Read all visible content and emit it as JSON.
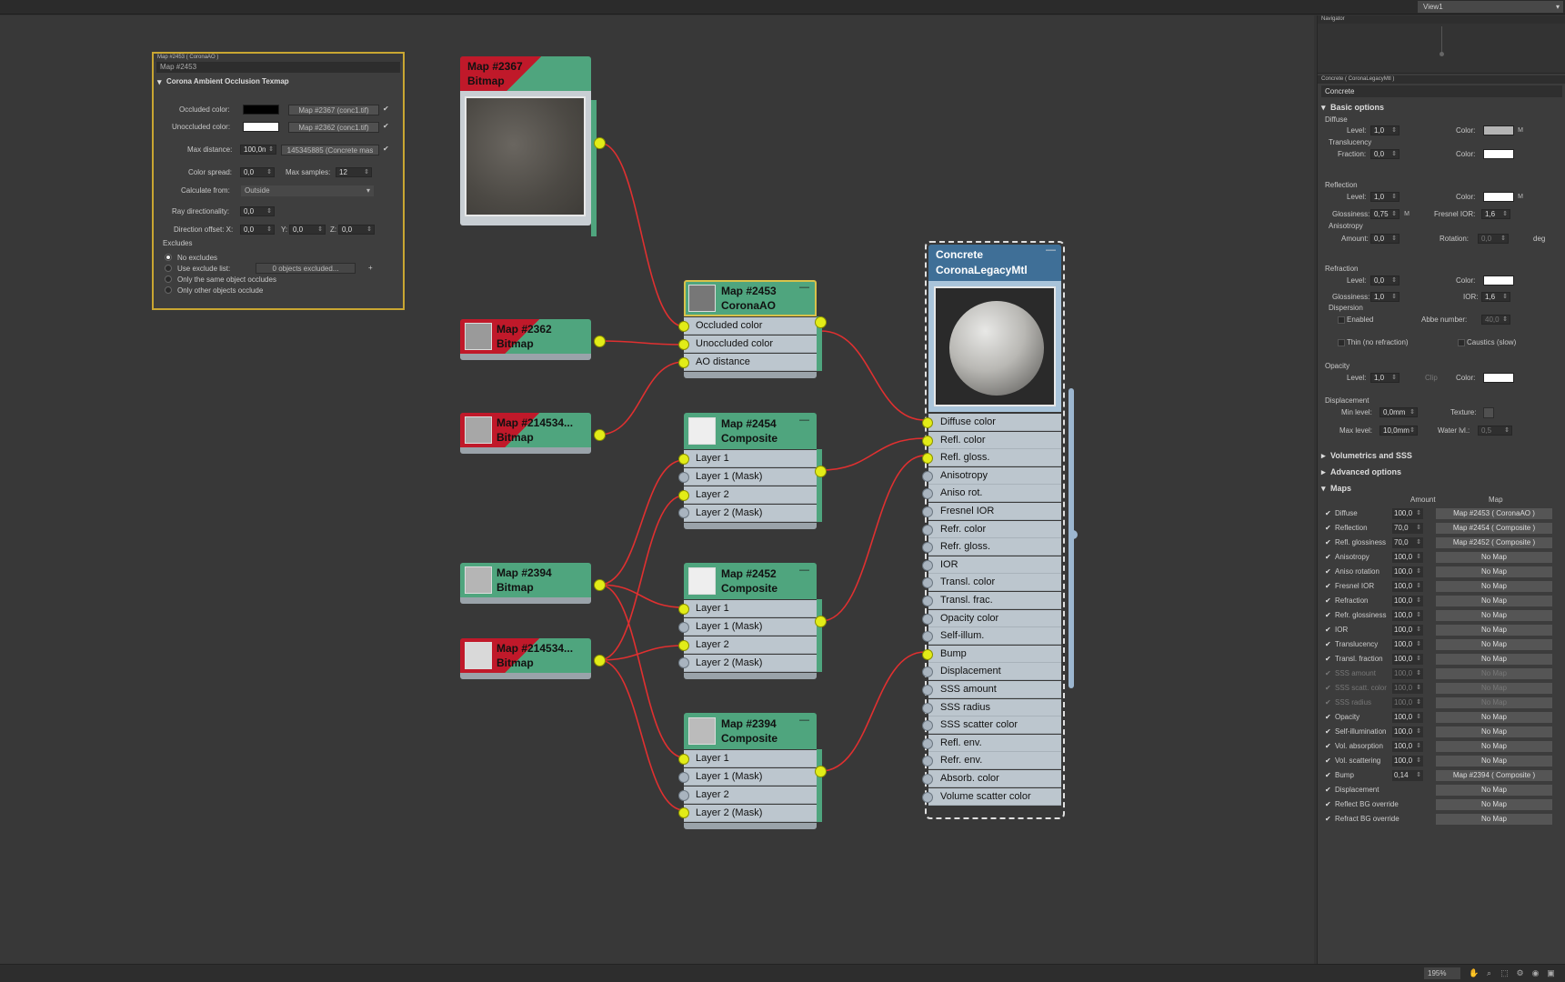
{
  "viewport": {
    "name": "View1"
  },
  "nav_title": "Navigator",
  "ao_panel": {
    "title": "Map #2453  ( CoronaAO )",
    "map_name": "Map #2453",
    "section": "Corona Ambient Occlusion Texmap",
    "occluded_label": "Occluded color:",
    "occluded_map": "Map #2367 (conc1.tif)",
    "unoccluded_label": "Unoccluded color:",
    "unoccluded_map": "Map #2362 (conc1.tif)",
    "maxdist_label": "Max distance:",
    "maxdist_value": "100,0n",
    "maxdist_map": "145345885 (Concrete mas",
    "spread_label": "Color spread:",
    "spread_value": "0,0",
    "samples_label": "Max samples:",
    "samples_value": "12",
    "calc_label": "Calculate from:",
    "calc_value": "Outside",
    "ray_label": "Ray directionality:",
    "ray_value": "0,0",
    "offset_label": "Direction offset: X:",
    "offset_x": "0,0",
    "offset_y_label": "Y:",
    "offset_y": "0,0",
    "offset_z_label": "Z:",
    "offset_z": "0,0",
    "excludes_label": "Excludes",
    "ex_none": "No excludes",
    "ex_list": "Use exclude list:",
    "ex_list_btn": "0 objects excluded...",
    "ex_same": "Only the same object occludes",
    "ex_other": "Only other objects occlude",
    "colors": {
      "occluded": "#000000",
      "unoccluded": "#ffffff"
    }
  },
  "nodes": {
    "bmp2367": {
      "line1": "Map #2367",
      "line2": "Bitmap"
    },
    "bmp2362": {
      "line1": "Map #2362",
      "line2": "Bitmap"
    },
    "bmp214534a": {
      "line1": "Map #214534...",
      "line2": "Bitmap"
    },
    "bmp2394": {
      "line1": "Map #2394",
      "line2": "Bitmap"
    },
    "bmp214534b": {
      "line1": "Map #214534...",
      "line2": "Bitmap"
    },
    "ao": {
      "line1": "Map #2453",
      "line2": "CoronaAO",
      "slots": [
        "Occluded color",
        "Unoccluded color",
        "AO distance"
      ]
    },
    "comp2454": {
      "line1": "Map #2454",
      "line2": "Composite",
      "slots": [
        "Layer 1",
        "Layer 1 (Mask)",
        "Layer 2",
        "Layer 2 (Mask)"
      ]
    },
    "comp2452": {
      "line1": "Map #2452",
      "line2": "Composite",
      "slots": [
        "Layer 1",
        "Layer 1 (Mask)",
        "Layer 2",
        "Layer 2 (Mask)"
      ]
    },
    "comp2394": {
      "line1": "Map #2394",
      "line2": "Composite",
      "slots": [
        "Layer 1",
        "Layer 1 (Mask)",
        "Layer 2",
        "Layer 2 (Mask)"
      ]
    },
    "mtl": {
      "line1": "Concrete",
      "line2": "CoronaLegacyMtl",
      "slots": [
        "Diffuse color",
        "Refl. color",
        "Refl. gloss.",
        "Anisotropy",
        "Aniso rot.",
        "Fresnel IOR",
        "Refr. color",
        "Refr. gloss.",
        "IOR",
        "Transl. color",
        "Transl. frac.",
        "Opacity color",
        "Self-illum.",
        "Bump",
        "Displacement",
        "SSS amount",
        "SSS radius",
        "SSS scatter color",
        "Refl. env.",
        "Refr. env.",
        "Absorb. color",
        "Volume scatter color"
      ]
    }
  },
  "side": {
    "title": "Concrete  ( CoronaLegacyMtl )",
    "mtl_name": "Concrete",
    "basic": "Basic options",
    "diffuse": "Diffuse",
    "level": "Level:",
    "color": "Color:",
    "diffuse_level": "1,0",
    "translucency": "Translucency",
    "fraction": "Fraction:",
    "transl_fraction": "0,0",
    "reflection": "Reflection",
    "refl_level": "1,0",
    "glossiness": "Glossiness:",
    "refl_gloss": "0,75",
    "fresnel": "Fresnel IOR:",
    "fresnel_val": "1,6",
    "anisotropy": "Anisotropy",
    "amount": "Amount:",
    "aniso_amount": "0,0",
    "rotation": "Rotation:",
    "rotation_val": "0,0",
    "deg": "deg",
    "refraction": "Refraction",
    "refr_level": "0,0",
    "refr_gloss": "1,0",
    "ior": "IOR:",
    "ior_val": "1,6",
    "dispersion": "Dispersion",
    "enabled": "Enabled",
    "abbe": "Abbe number:",
    "abbe_val": "40,0",
    "thin": "Thin (no refraction)",
    "caustics": "Caustics (slow)",
    "opacity": "Opacity",
    "opac_level": "1,0",
    "clip": "Clip",
    "displacement": "Displacement",
    "min_level": "Min level:",
    "min_val": "0,0mm",
    "texture": "Texture:",
    "max_level": "Max level:",
    "max_val": "10,0mm",
    "water": "Water lvl.:",
    "water_val": "0,5",
    "m": "M",
    "volumetrics": "Volumetrics and SSS",
    "advanced": "Advanced options",
    "maps": "Maps",
    "col_amount": "Amount",
    "col_map": "Map",
    "map_rows": [
      {
        "name": "Diffuse",
        "amount": "100,0",
        "map": "Map #2453  ( CoronaAO )",
        "dis": false
      },
      {
        "name": "Reflection",
        "amount": "70,0",
        "map": "Map #2454  ( Composite )",
        "dis": false
      },
      {
        "name": "Refl. glossiness",
        "amount": "70,0",
        "map": "Map #2452  ( Composite )",
        "dis": false
      },
      {
        "name": "Anisotropy",
        "amount": "100,0",
        "map": "No Map",
        "dis": false
      },
      {
        "name": "Aniso rotation",
        "amount": "100,0",
        "map": "No Map",
        "dis": false
      },
      {
        "name": "Fresnel IOR",
        "amount": "100,0",
        "map": "No Map",
        "dis": false
      },
      {
        "name": "Refraction",
        "amount": "100,0",
        "map": "No Map",
        "dis": false
      },
      {
        "name": "Refr. glossiness",
        "amount": "100,0",
        "map": "No Map",
        "dis": false
      },
      {
        "name": "IOR",
        "amount": "100,0",
        "map": "No Map",
        "dis": false
      },
      {
        "name": "Translucency",
        "amount": "100,0",
        "map": "No Map",
        "dis": false
      },
      {
        "name": "Transl. fraction",
        "amount": "100,0",
        "map": "No Map",
        "dis": false
      },
      {
        "name": "SSS amount",
        "amount": "100,0",
        "map": "No Map",
        "dis": true
      },
      {
        "name": "SSS scatt. color",
        "amount": "100,0",
        "map": "No Map",
        "dis": true
      },
      {
        "name": "SSS radius",
        "amount": "100,0",
        "map": "No Map",
        "dis": true
      },
      {
        "name": "Opacity",
        "amount": "100,0",
        "map": "No Map",
        "dis": false
      },
      {
        "name": "Self-illumination",
        "amount": "100,0",
        "map": "No Map",
        "dis": false
      },
      {
        "name": "Vol. absorption",
        "amount": "100,0",
        "map": "No Map",
        "dis": false
      },
      {
        "name": "Vol. scattering",
        "amount": "100,0",
        "map": "No Map",
        "dis": false
      },
      {
        "name": "Bump",
        "amount": "0,14",
        "map": "Map #2394  ( Composite )",
        "dis": false
      },
      {
        "name": "Displacement",
        "amount": "",
        "map": "No Map",
        "dis": false
      },
      {
        "name": "Reflect BG override",
        "amount": "",
        "map": "No Map",
        "dis": false
      },
      {
        "name": "Refract BG override",
        "amount": "",
        "map": "No Map",
        "dis": false
      }
    ]
  },
  "status": {
    "zoom": "195%"
  },
  "colors": {
    "wire": "#e03030",
    "node_green": "#4fa57e",
    "bitmap_red": "#c0192a",
    "socket_yellow": "#e2ec18",
    "ao_border": "#c9a632"
  }
}
